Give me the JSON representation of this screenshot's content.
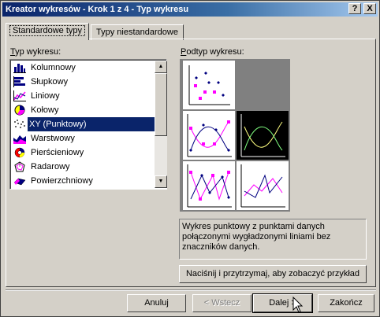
{
  "window": {
    "title": "Kreator wykresów - Krok 1 z 4 - Typ wykresu",
    "help_label": "?",
    "close_label": "X"
  },
  "tabs": [
    {
      "label": "Standardowe typy",
      "active": true
    },
    {
      "label": "Typy niestandardowe",
      "active": false
    }
  ],
  "chart_types": {
    "label_prefix": "T",
    "label_rest": "yp wykresu:",
    "items": [
      {
        "label": "Kolumnowy",
        "icon": "column-chart-icon"
      },
      {
        "label": "Słupkowy",
        "icon": "bar-chart-icon"
      },
      {
        "label": "Liniowy",
        "icon": "line-chart-icon"
      },
      {
        "label": "Kołowy",
        "icon": "pie-chart-icon"
      },
      {
        "label": "XY (Punktowy)",
        "icon": "scatter-chart-icon",
        "selected": true
      },
      {
        "label": "Warstwowy",
        "icon": "area-chart-icon"
      },
      {
        "label": "Pierścieniowy",
        "icon": "doughnut-chart-icon"
      },
      {
        "label": "Radarowy",
        "icon": "radar-chart-icon"
      },
      {
        "label": "Powierzchniowy",
        "icon": "surface-chart-icon"
      }
    ]
  },
  "subtypes": {
    "label_prefix": "P",
    "label_rest": "odtyp wykresu:",
    "selected_index": 2
  },
  "description": "Wykres punktowy z punktami danych połączonymi wygładzonymi liniami bez znaczników danych.",
  "preview_button": {
    "label": "Naciśnij i przytrzymaj, aby zobaczyć przykład"
  },
  "buttons": {
    "cancel": "Anuluj",
    "back": "< Wstecz",
    "next": "Dalej >",
    "finish": "Zakończ"
  },
  "colors": {
    "accent": "#0a246a",
    "marker_pink": "#ff00ff",
    "marker_navy": "#000080",
    "curve_green": "#80ff80",
    "curve_yellow": "#ffff80"
  }
}
